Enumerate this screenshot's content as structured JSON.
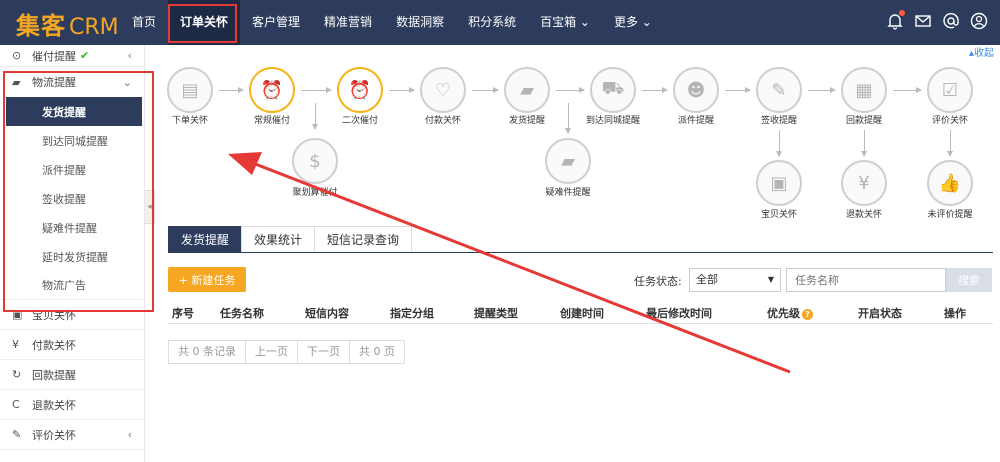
{
  "logo": {
    "cn": "集客",
    "en": "CRM"
  },
  "nav": [
    "首页",
    "订单关怀",
    "客户管理",
    "精准营销",
    "数据洞察",
    "积分系统",
    "百宝箱 ⌄",
    "更多 ⌄"
  ],
  "sidebar": {
    "top_item": "催付提醒",
    "group": "物流提醒",
    "sub_items": [
      "发货提醒",
      "到达同城提醒",
      "派件提醒",
      "签收提醒",
      "疑难件提醒",
      "延时发货提醒",
      "物流广告"
    ],
    "bottom_items": [
      {
        "icon": "gift-icon",
        "label": "宝贝关怀"
      },
      {
        "icon": "yen-icon",
        "label": "付款关怀"
      },
      {
        "icon": "refresh-icon",
        "label": "回款提醒"
      },
      {
        "icon": "rotate-icon",
        "label": "退款关怀"
      },
      {
        "icon": "pencil-icon",
        "label": "评价关怀"
      }
    ]
  },
  "collapse_label": "收起",
  "flow": {
    "nodes": [
      "下单关怀",
      "常规催付",
      "二次催付",
      "付款关怀",
      "发货提醒",
      "到达同城提醒",
      "派件提醒",
      "签收提醒",
      "回款提醒",
      "评价关怀"
    ],
    "branch_nodes": [
      "聚划算催付",
      "疑难件提醒",
      "宝贝关怀",
      "退款关怀",
      "未评价提醒"
    ]
  },
  "tabs": [
    "发货提醒",
    "效果统计",
    "短信记录查询"
  ],
  "toolbar": {
    "new_task": "+ 新建任务",
    "status_label": "任务状态:",
    "status_value": "全部",
    "name_placeholder": "任务名称",
    "search": "搜索"
  },
  "table": {
    "columns": [
      "序号",
      "任务名称",
      "短信内容",
      "指定分组",
      "提醒类型",
      "创建时间",
      "最后修改时间",
      "优先级",
      "开启状态",
      "操作"
    ]
  },
  "pager": [
    "共 0 条记录",
    "上一页",
    "下一页",
    "共 0 页"
  ],
  "colors": {
    "nav_bg": "#2d3c5c",
    "accent": "#f5a623",
    "annotation": "#e53935"
  }
}
